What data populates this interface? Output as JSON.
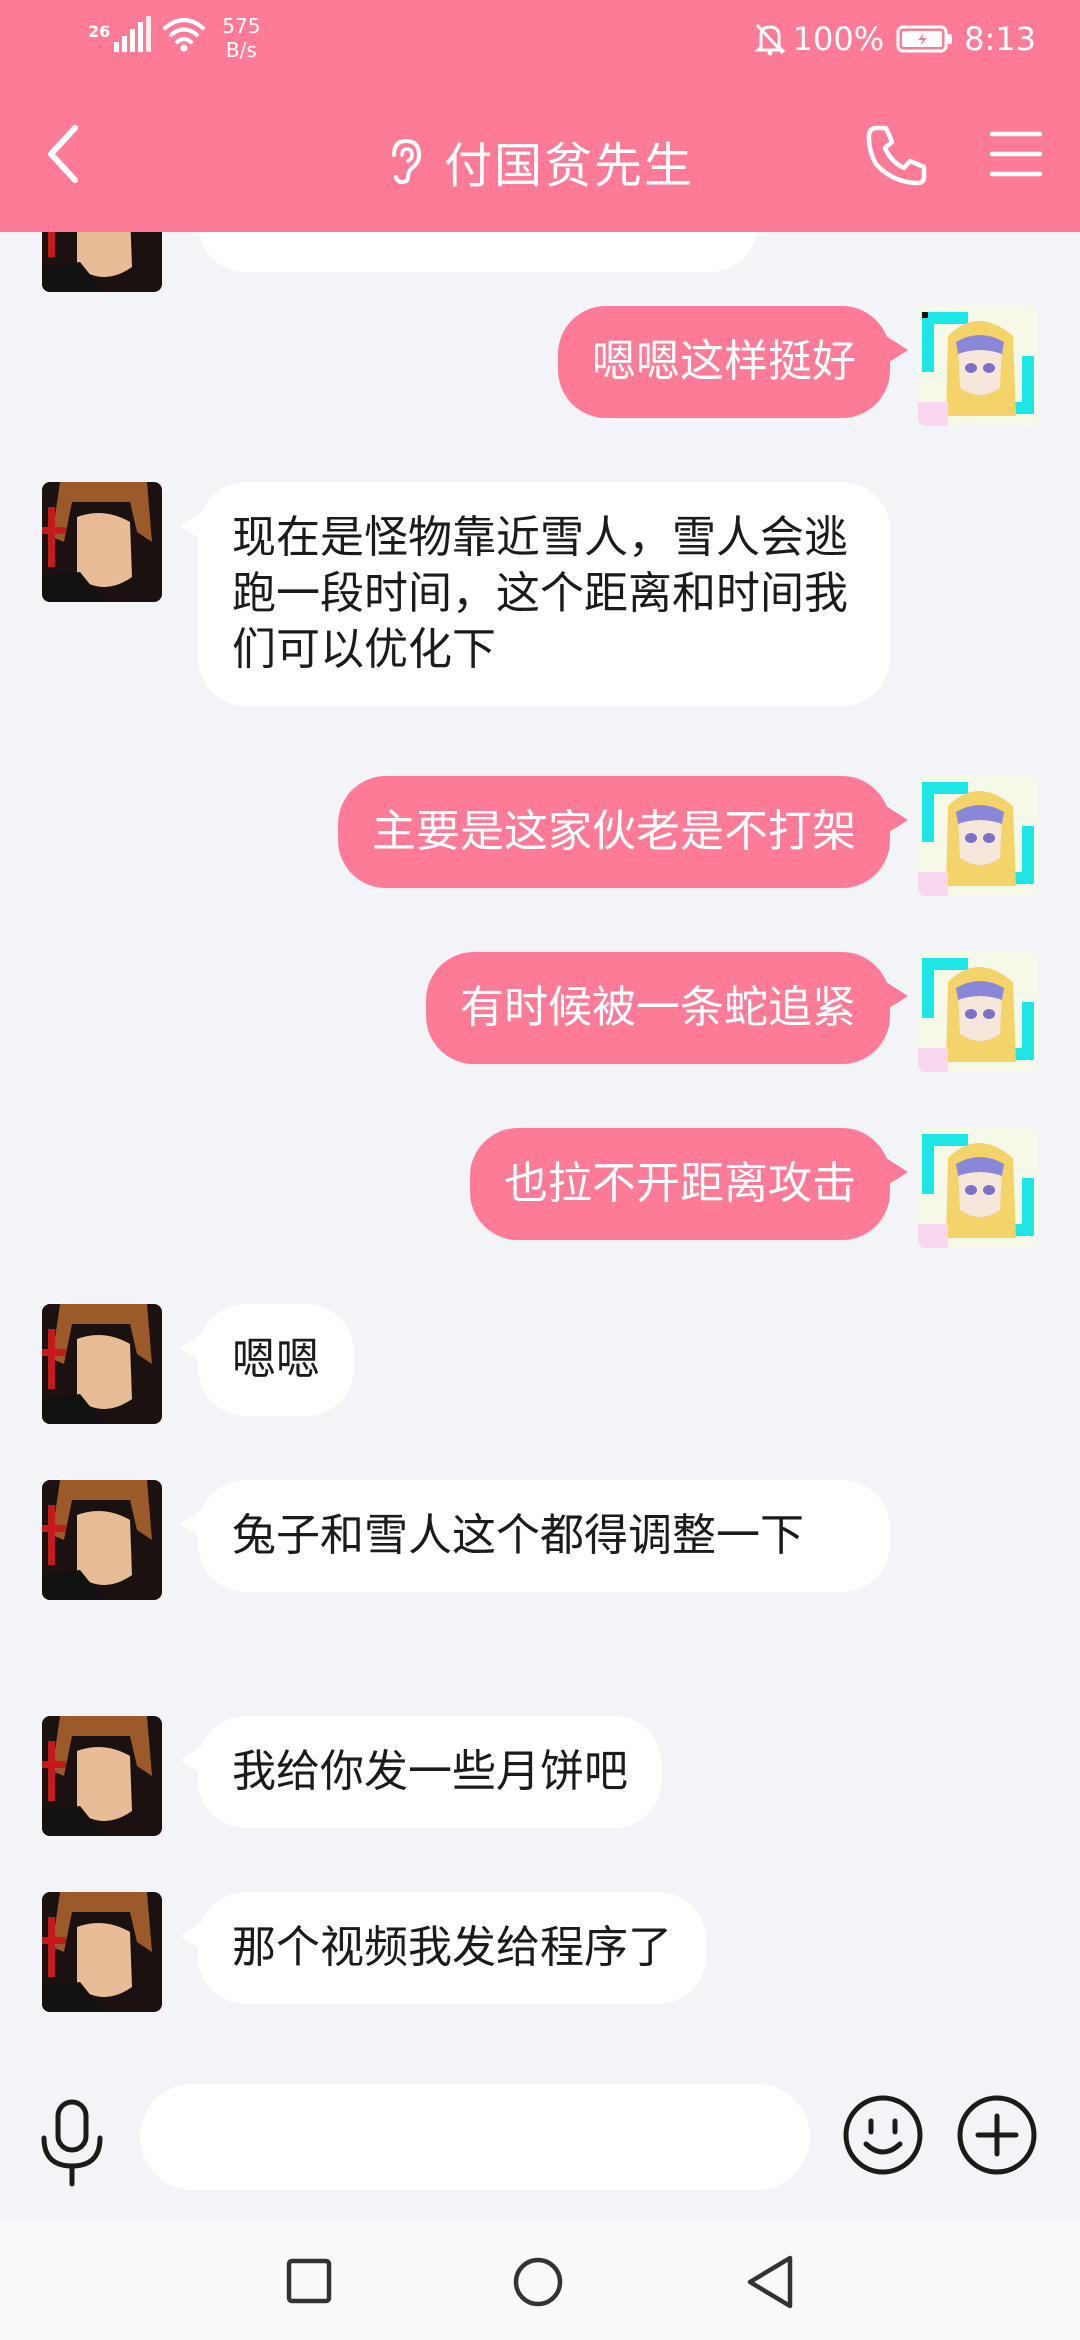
{
  "status_bar": {
    "network": "26",
    "speed_value": "575",
    "speed_unit": "B/s",
    "battery": "100%",
    "time": "8:13"
  },
  "header": {
    "title": "付国贫先生",
    "bg_color": "#fd7b97"
  },
  "colors": {
    "accent": "#fd7b97",
    "chat_bg": "#f3f4f8",
    "incoming_bubble": "#ffffff",
    "outgoing_text": "#ffffff"
  },
  "messages": [
    {
      "side": "right",
      "text": "嗯嗯这样挺好"
    },
    {
      "side": "left",
      "text": "现在是怪物靠近雪人，雪人会逃跑一段时间，这个距离和时间我们可以优化下"
    },
    {
      "side": "right",
      "text": "主要是这家伙老是不打架"
    },
    {
      "side": "right",
      "text": "有时候被一条蛇追紧"
    },
    {
      "side": "right",
      "text": "也拉不开距离攻击"
    },
    {
      "side": "left",
      "text": "嗯嗯"
    },
    {
      "side": "left",
      "text": "兔子和雪人这个都得调整一下"
    },
    {
      "side": "left",
      "text": "我给你发一些月饼吧"
    },
    {
      "side": "left",
      "text": "那个视频我发给程序了"
    }
  ],
  "input": {
    "value": "",
    "placeholder": ""
  },
  "icons": {
    "back": "chevron-left-icon",
    "ear": "ear-icon",
    "call": "phone-icon",
    "menu": "hamburger-menu-icon",
    "mic": "microphone-icon",
    "emoji": "smiley-icon",
    "plus": "plus-circle-icon"
  }
}
